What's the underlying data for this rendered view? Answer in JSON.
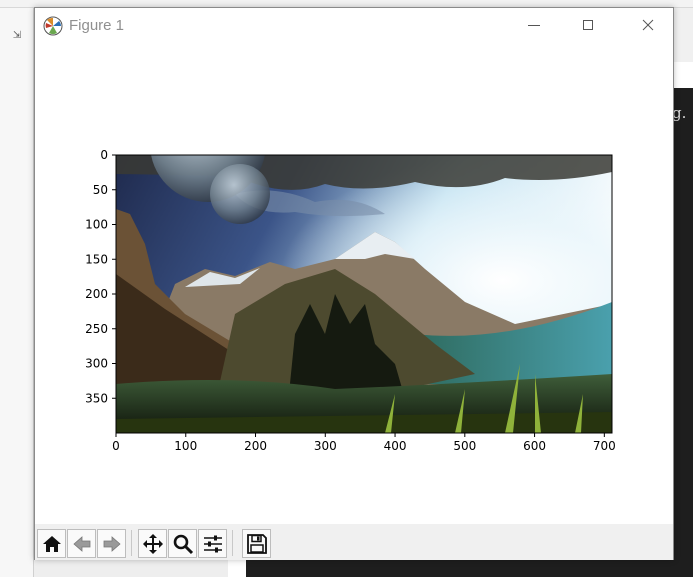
{
  "window": {
    "title": "Figure 1",
    "controls": [
      "minimize-icon",
      "maximize-icon",
      "close-icon"
    ]
  },
  "background": {
    "terminal_text": "g."
  },
  "toolbar": {
    "tools": [
      {
        "name": "home-button",
        "icon": "home-icon"
      },
      {
        "name": "back-button",
        "icon": "arrow-left-icon"
      },
      {
        "name": "forward-button",
        "icon": "arrow-right-icon"
      },
      {
        "name": "pan-button",
        "icon": "move-icon"
      },
      {
        "name": "zoom-button",
        "icon": "magnifier-icon"
      },
      {
        "name": "subplots-button",
        "icon": "sliders-icon"
      },
      {
        "name": "save-button",
        "icon": "floppy-disk-icon"
      }
    ]
  },
  "chart_data": {
    "type": "image",
    "x_ticks": [
      "0",
      "100",
      "200",
      "300",
      "400",
      "500",
      "600",
      "700"
    ],
    "y_ticks": [
      "0",
      "50",
      "100",
      "150",
      "200",
      "250",
      "300",
      "350"
    ],
    "xlim": [
      0,
      711
    ],
    "ylim": [
      400,
      0
    ],
    "image_description_icon": "mountain-landscape-image",
    "colors": {
      "sky_dark": "#2b3a63",
      "sky_light": "#f6fbff",
      "haze": "#bfe3ec",
      "mountain": "#6e5a44",
      "grass": "#2c3a12",
      "teal": "#3e8a8f"
    }
  }
}
